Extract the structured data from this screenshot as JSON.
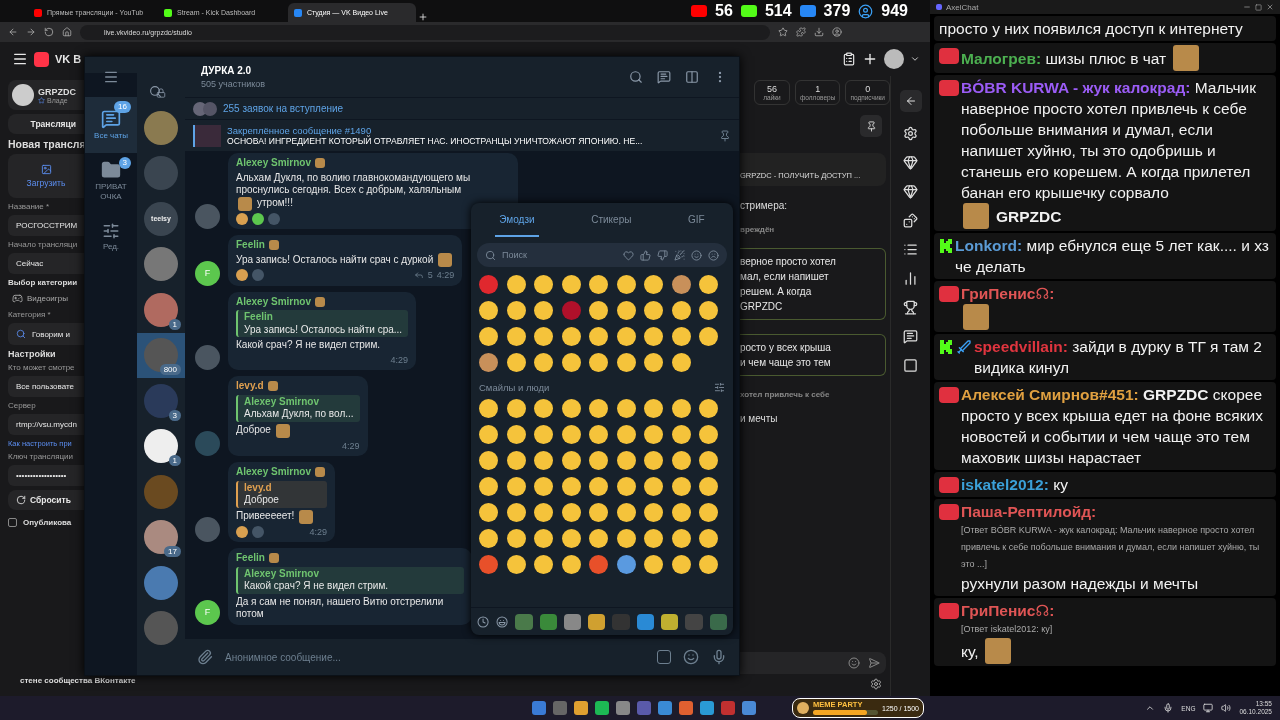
{
  "browser": {
    "tabs": [
      {
        "title": "Прямые трансляции - YouTub",
        "kind": "youtube",
        "selected": false
      },
      {
        "title": "Stream - Kick Dashboard",
        "kind": "kick",
        "selected": false
      },
      {
        "title": "Студия — VK Видео Live",
        "kind": "vk",
        "selected": true
      }
    ],
    "url": "live.vkvideo.ru/grpzdc/studio",
    "overlay_counters": [
      {
        "kind": "youtube",
        "value": "56"
      },
      {
        "kind": "kick",
        "value": "514"
      },
      {
        "kind": "vk",
        "value": "379"
      },
      {
        "kind": "viewers",
        "value": "949"
      }
    ]
  },
  "vk": {
    "logo_text": "VK В",
    "profile": {
      "name": "GRPZDC",
      "role": "Владе"
    },
    "form": {
      "tab": "Трансляци",
      "title": "Новая трансля",
      "upload": "Загрузить",
      "fields": [
        {
          "label": "Название *",
          "value": "РОСГОССТРИМ",
          "kind": "input"
        },
        {
          "label": "Начало трансляци",
          "value": "Сейчас",
          "kind": "input"
        },
        {
          "label": "Выбор категории",
          "value": "Видеоигры",
          "kind": "category"
        },
        {
          "label": "Категория *",
          "value": "Говорим и",
          "kind": "search"
        },
        {
          "label": "Настройки",
          "kind": "heading"
        },
        {
          "label": "Кто может смотре",
          "value": "Все пользовате",
          "kind": "input"
        },
        {
          "label": "Сервер",
          "value": "rtmp://vsu.mycdn",
          "kind": "input"
        },
        {
          "label": "Как настроить при",
          "kind": "link"
        },
        {
          "label": "Ключ трансляции",
          "value": "••••••••••••••••••",
          "kind": "input"
        }
      ],
      "reset": "Сбросить",
      "publish_line1": "Опубликова",
      "publish_line2": "стене сообщества ВКонтакте",
      "publish_checked": false
    },
    "stats": [
      {
        "value": "56",
        "label": "лайки"
      },
      {
        "value": "1",
        "label": "фолловеры"
      },
      {
        "value": "0",
        "label": "подписчики"
      }
    ],
    "chat_fragments": [
      {
        "kind": "notice",
        "text": "GRPZDC - ПОЛУЧИТЬ ДОСТУП ..."
      },
      {
        "kind": "plain",
        "text": "стримера:"
      },
      {
        "kind": "muted",
        "text": "вреждён"
      },
      {
        "kind": "boxed",
        "lines": [
          "верное просто хотел",
          "мал, если напишет",
          "решем. А когда",
          "GRPZDC"
        ]
      },
      {
        "kind": "boxed",
        "lines": [
          "росто у всех крыша",
          "и чем чаще это тем"
        ]
      },
      {
        "kind": "muted",
        "text": "хотел привлечь к себе"
      },
      {
        "kind": "plain",
        "text": "и мечты"
      }
    ]
  },
  "telegram": {
    "title": "ДУРКА 2.0",
    "subtitle": "505 участников",
    "folders": [
      {
        "label": "Все чаты",
        "badge": "16",
        "kind": "chats",
        "selected": true
      },
      {
        "label": "ПРИВАТ ОЧКА",
        "badge": "3",
        "kind": "folder",
        "selected": false
      },
      {
        "label": "Ред.",
        "kind": "edit",
        "selected": false
      }
    ],
    "chats": [
      {
        "kind": "lock",
        "selected": false
      },
      {
        "kind": "photo",
        "selected": false
      },
      {
        "kind": "photo",
        "selected": false
      },
      {
        "kind": "logo",
        "text": "teelsy",
        "selected": false
      },
      {
        "kind": "photo",
        "selected": false
      },
      {
        "kind": "photo",
        "badge": "1",
        "selected": false
      },
      {
        "kind": "photo",
        "badge": "800",
        "selected": true
      },
      {
        "kind": "photo",
        "badge": "3",
        "selected": false
      },
      {
        "kind": "photo",
        "badge": "1",
        "selected": false
      },
      {
        "kind": "photo",
        "selected": false
      },
      {
        "kind": "photo",
        "badge": "17",
        "selected": false
      },
      {
        "kind": "photo",
        "selected": false
      },
      {
        "kind": "photo",
        "selected": false
      }
    ],
    "join_requests": "255 заявок на вступление",
    "pinned": {
      "title": "Закреплённое сообщение #1490",
      "text": "ОСНОВА! ИНГРЕДИЕНТ КОТОРЫЙ ОТРАВЛЯЕТ НАС. ИНОСТРАНЦЫ УНИЧТОЖАЮТ ЯПОНИЮ. НЕ..."
    },
    "messages": [
      {
        "author": "Alexey Smirnov",
        "color": "#6fc46f",
        "avatar": {
          "kind": "photo"
        },
        "parts": [
          {
            "kind": "text",
            "text": "Альхам Дукля, по волию главнокомандующего мы проснулись сегодня. Всех с добрым, халяльным"
          },
          {
            "kind": "sticker"
          },
          {
            "kind": "text",
            "text": "утром!!!"
          }
        ],
        "reactions": [
          {
            "kind": "emoji"
          },
          {
            "kind": "letter"
          },
          {
            "kind": "emblem"
          }
        ]
      },
      {
        "author": "Feelin",
        "color": "#6fc46f",
        "avatar": {
          "kind": "letter",
          "letter": "F"
        },
        "parts": [
          {
            "kind": "text",
            "text": "Ура запись! Осталось найти срач с дуркой"
          },
          {
            "kind": "sticker"
          }
        ],
        "reactions": [
          {
            "kind": "emoji"
          },
          {
            "kind": "emblem"
          }
        ],
        "replies": "5",
        "time": "4:29"
      },
      {
        "author": "Alexey Smirnov",
        "color": "#6fc46f",
        "avatar": {
          "kind": "photo"
        },
        "quote": {
          "author": "Feelin",
          "text": "Ура запись! Осталось найти сра...",
          "color": "#6fc46f"
        },
        "parts": [
          {
            "kind": "text",
            "text": "Какой срач? Я не видел стрим."
          }
        ],
        "time": "4:29"
      },
      {
        "author": "levy.d",
        "color": "#e0a050",
        "avatar": {
          "kind": "emblem"
        },
        "quote": {
          "author": "Alexey Smirnov",
          "text": "Альхам Дукля, по вол...",
          "color": "#6fc46f"
        },
        "parts": [
          {
            "kind": "text",
            "text": "Доброе"
          },
          {
            "kind": "sticker"
          }
        ],
        "time": "4:29"
      },
      {
        "author": "Alexey Smirnov",
        "color": "#6fc46f",
        "avatar": {
          "kind": "photo"
        },
        "quote": {
          "author": "levy.d",
          "text": "Доброе",
          "color": "#e0a050"
        },
        "parts": [
          {
            "kind": "text",
            "text": "Привееееет!"
          },
          {
            "kind": "sticker"
          }
        ],
        "reactions": [
          {
            "kind": "emoji"
          },
          {
            "kind": "emblem"
          }
        ],
        "time": "4:29"
      },
      {
        "author": "Feelin",
        "color": "#6fc46f",
        "avatar": {
          "kind": "letter",
          "letter": "F"
        },
        "quote": {
          "author": "Alexey Smirnov",
          "text": "Какой срач? Я не видел стрим.",
          "color": "#6fc46f"
        },
        "parts": [
          {
            "kind": "text",
            "text": "Да я сам не понял, нашего Витю отстрелили потом"
          }
        ]
      }
    ],
    "input_placeholder": "Анонимное сообщение...",
    "emoji_panel": {
      "tabs": [
        {
          "label": "Эмодзи",
          "selected": true
        },
        {
          "label": "Стикеры",
          "selected": false
        },
        {
          "label": "GIF",
          "selected": false
        }
      ],
      "search_placeholder": "Поиск",
      "section": "Смайлы и люди"
    }
  },
  "axelchat": {
    "title": "AxelChat",
    "messages": [
      {
        "kind": "none",
        "parts": [
          {
            "kind": "text",
            "text": "просто у них появился доступ к интернету"
          }
        ]
      },
      {
        "kind": "vk",
        "author": "Малогрев:",
        "color": "#4caf50",
        "parts": [
          {
            "kind": "text",
            "text": "шизы плюс в чат"
          },
          {
            "kind": "sticker"
          }
        ]
      },
      {
        "kind": "vk",
        "author": "BÓBR KURWA - жук калокрад:",
        "color": "#9b5cf6",
        "parts": [
          {
            "kind": "text",
            "text": "Мальчик наверное просто хотел привлечь к себе побольше внимания и думал, если напишет хуйню, ты это одобришь и станешь его корешем. А когда прилетел банан его крышечку сорвало"
          },
          {
            "kind": "sticker"
          },
          {
            "kind": "mention",
            "text": "GRPZDC"
          }
        ]
      },
      {
        "kind": "kick",
        "author": "Lonkord:",
        "color": "#5b9bd5",
        "parts": [
          {
            "kind": "text",
            "text": "мир ебнулся еще 5 лет как.... и хз че делать"
          }
        ]
      },
      {
        "kind": "vk",
        "author": "ГриПенис☊:",
        "color": "#e05555",
        "parts": [
          {
            "kind": "sticker"
          }
        ]
      },
      {
        "kind": "kick",
        "sword": true,
        "author": "speedvillain:",
        "color": "#e0353f",
        "parts": [
          {
            "kind": "text",
            "text": "зайди в дурку в ТГ я там 2 видика кинул"
          }
        ]
      },
      {
        "kind": "vk",
        "author": "Алексей Смирнов#451:",
        "color": "#e0a040",
        "parts": [
          {
            "kind": "text",
            "text": "**GRPZDC** скорее просто у всех крыша едет на фоне всяких новостей и событии и чем чаще это тем маховик шизы нарастает"
          }
        ]
      },
      {
        "kind": "vk",
        "author": "iskatel2012:",
        "color": "#3ba0d8",
        "parts": [
          {
            "kind": "text",
            "text": "ку"
          }
        ]
      },
      {
        "kind": "vk",
        "author": "Паша-Рептилойд:",
        "color": "#e05555",
        "reply": "[Ответ BÓBR KURWA - жук калокрад: Мальчик наверное просто хотел привлечь к себе побольше внимания и думал, если напишет хуйню, ты это ...]",
        "parts": [
          {
            "kind": "text",
            "text": "рухнули разом надежды и мечты"
          }
        ]
      },
      {
        "kind": "vk",
        "author": "ГриПенис☊:",
        "color": "#e05555",
        "reply": "[Ответ iskatel2012: ку]",
        "parts": [
          {
            "kind": "text",
            "text": "ку,"
          },
          {
            "kind": "sticker"
          }
        ]
      }
    ]
  },
  "taskbar": {
    "widget": {
      "title": "MEME PARTY",
      "progress": "1250 / 1500",
      "level": 0.83
    },
    "language": "ENG",
    "time": "13:55",
    "date": "06.10.2025"
  }
}
